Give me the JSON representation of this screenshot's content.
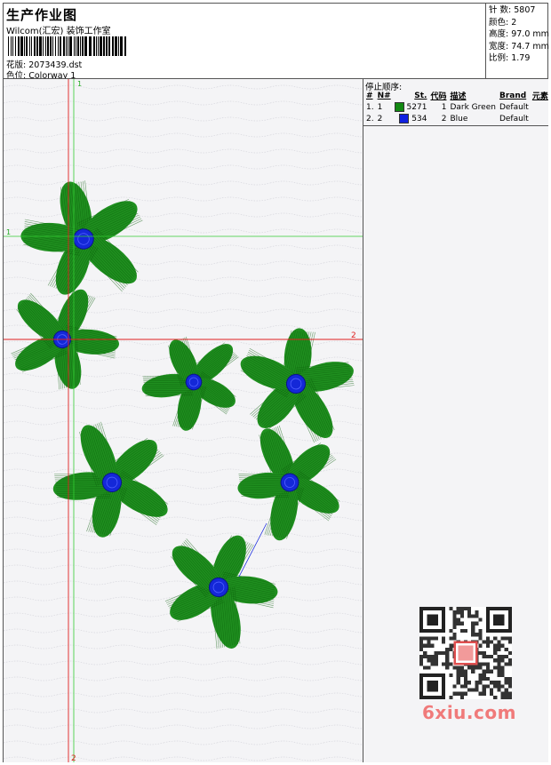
{
  "header": {
    "title": "生产作业图",
    "company": "Wilcom(汇宏) 装饰工作室",
    "design_label": "花版:",
    "design_value": "2073439.dst",
    "colorway_label": "色位:",
    "colorway_value": "Colorway 1"
  },
  "stats": {
    "stitches": "针 数:  5807",
    "colors": "颜色:  2",
    "height": "高度:  97.0 mm",
    "width": "宽度:  74.7 mm",
    "ratio": "比例:  1.79"
  },
  "stop_sequence": {
    "heading": "停止顺序:",
    "columns": [
      "#",
      "N#",
      "St.",
      "代码",
      "描述",
      "Brand",
      "元素"
    ],
    "rows": [
      {
        "idx": "1.",
        "n": "1",
        "color": "#118811",
        "stitches": "5271",
        "code": "1",
        "desc": "Dark Green",
        "brand": "Default"
      },
      {
        "idx": "2.",
        "n": "2",
        "color": "#1020e0",
        "stitches": "534",
        "code": "2",
        "desc": "Blue",
        "brand": "Default"
      }
    ]
  },
  "guides": {
    "green_label_top": "1",
    "green_label_left": "1",
    "red_label_right": "2",
    "red_label_bottom": "2"
  },
  "colors": {
    "green": "#1f8f1f",
    "green_dark": "#0b5f0b",
    "blue": "#1428d8",
    "guide_green": "#33cc33",
    "guide_red": "#e02020"
  },
  "watermark": "6xiu.com"
}
